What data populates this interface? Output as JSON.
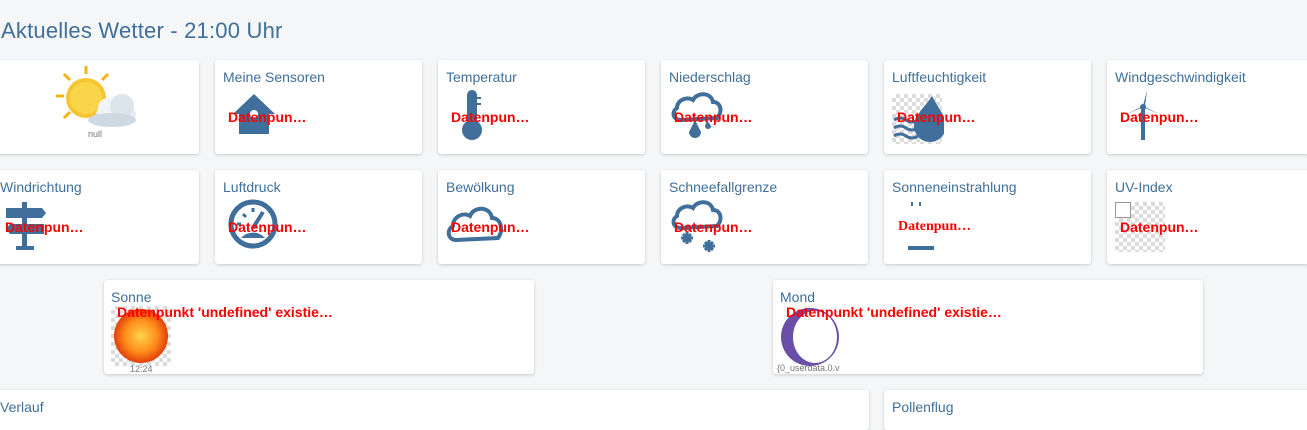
{
  "page": {
    "title": "Aktuelles Wetter - 21:00 Uhr"
  },
  "accent_color": "#3f6f9a",
  "error_color": "#ff0000",
  "row1": [
    {
      "caption": "null"
    },
    {
      "title": "Meine Sensoren",
      "value": "Datenpun…",
      "icon": "home-icon"
    },
    {
      "title": "Temperatur",
      "value": "Datenpun…",
      "icon": "thermometer-icon"
    },
    {
      "title": "Niederschlag",
      "value": "Datenpun…",
      "icon": "cloud-rain-icon"
    },
    {
      "title": "Luftfeuchtigkeit",
      "value": "Datenpun…",
      "icon": "humidity-drop-icon"
    },
    {
      "title": "Windgeschwindigkeit",
      "value": "Datenpun…",
      "icon": "wind-turbine-icon"
    }
  ],
  "row2": [
    {
      "title": "Windrichtung",
      "value": "Datenpun…",
      "icon": "signpost-icon"
    },
    {
      "title": "Luftdruck",
      "value": "Datenpun…",
      "icon": "gauge-icon"
    },
    {
      "title": "Bewölkung",
      "value": "Datenpun…",
      "icon": "cloud-icon"
    },
    {
      "title": "Schneefallgrenze",
      "value": "Datenpun…",
      "icon": "cloud-snow-icon"
    },
    {
      "title": "Sonneneinstrahlung",
      "value": "Datenpun…",
      "icon": "sun-radiation-icon"
    },
    {
      "title": "UV-Index",
      "value": "Datenpun…",
      "icon": "broken-image-icon"
    }
  ],
  "sun": {
    "title": "Sonne",
    "value": "Datenpunkt 'undefined' existie…",
    "time": "12:24"
  },
  "moon": {
    "title": "Mond",
    "value": "Datenpunkt 'undefined' existie…",
    "caption": "{0_userdata.0.v"
  },
  "bottom": {
    "left_title": "Verlauf",
    "right_title": "Pollenflug"
  }
}
